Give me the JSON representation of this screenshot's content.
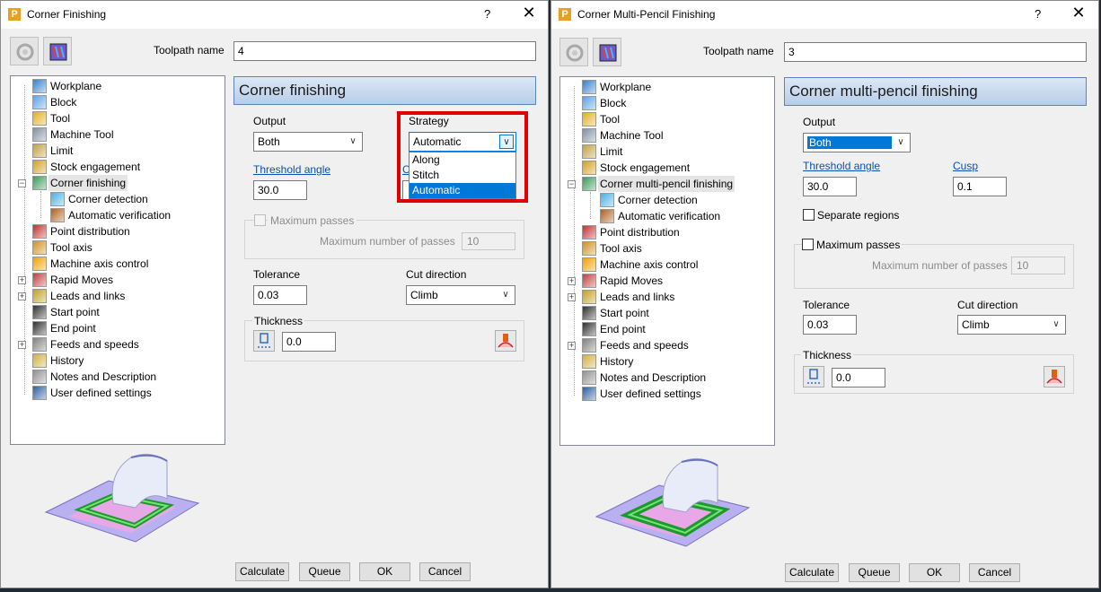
{
  "dialog1": {
    "title": "Corner Finishing",
    "help": "?",
    "close": "✕",
    "toolpath_name_label": "Toolpath name",
    "toolpath_name_value": "4",
    "tree": [
      {
        "label": "Workplane",
        "icon": "workplane-icon"
      },
      {
        "label": "Block",
        "icon": "block-icon"
      },
      {
        "label": "Tool",
        "icon": "tool-icon"
      },
      {
        "label": "Machine Tool",
        "icon": "machine-tool-icon"
      },
      {
        "label": "Limit",
        "icon": "limit-icon"
      },
      {
        "label": "Stock engagement",
        "icon": "stock-engagement-icon"
      },
      {
        "label": "Corner finishing",
        "icon": "corner-finishing-icon"
      },
      {
        "label": "Corner detection",
        "icon": "corner-detection-icon"
      },
      {
        "label": "Automatic verification",
        "icon": "verification-icon"
      },
      {
        "label": "Point distribution",
        "icon": "point-distribution-icon"
      },
      {
        "label": "Tool axis",
        "icon": "tool-axis-icon"
      },
      {
        "label": "Machine axis control",
        "icon": "machine-axis-icon"
      },
      {
        "label": "Rapid Moves",
        "icon": "rapid-moves-icon"
      },
      {
        "label": "Leads and links",
        "icon": "leads-links-icon"
      },
      {
        "label": "Start point",
        "icon": "start-point-icon"
      },
      {
        "label": "End point",
        "icon": "end-point-icon"
      },
      {
        "label": "Feeds and speeds",
        "icon": "feeds-speeds-icon"
      },
      {
        "label": "History",
        "icon": "history-icon"
      },
      {
        "label": "Notes and Description",
        "icon": "notes-icon"
      },
      {
        "label": "User defined settings",
        "icon": "user-settings-icon"
      }
    ],
    "section_title": "Corner finishing",
    "output_label": "Output",
    "output_value": "Both",
    "strategy_label": "Strategy",
    "strategy_value": "Automatic",
    "strategy_options": [
      "Along",
      "Stitch",
      "Automatic"
    ],
    "threshold_label": "Threshold angle",
    "threshold_value": "30.0",
    "cusp_partial": "C",
    "max_passes_label": "Maximum passes",
    "max_passes_number_label": "Maximum number of passes",
    "max_passes_number_value": "10",
    "tolerance_label": "Tolerance",
    "tolerance_value": "0.03",
    "cut_direction_label": "Cut direction",
    "cut_direction_value": "Climb",
    "thickness_label": "Thickness",
    "thickness_value": "0.0",
    "buttons": {
      "calculate": "Calculate",
      "queue": "Queue",
      "ok": "OK",
      "cancel": "Cancel"
    }
  },
  "dialog2": {
    "title": "Corner Multi-Pencil Finishing",
    "help": "?",
    "close": "✕",
    "toolpath_name_label": "Toolpath name",
    "toolpath_name_value": "3",
    "tree": [
      {
        "label": "Workplane",
        "icon": "workplane-icon"
      },
      {
        "label": "Block",
        "icon": "block-icon"
      },
      {
        "label": "Tool",
        "icon": "tool-icon"
      },
      {
        "label": "Machine Tool",
        "icon": "machine-tool-icon"
      },
      {
        "label": "Limit",
        "icon": "limit-icon"
      },
      {
        "label": "Stock engagement",
        "icon": "stock-engagement-icon"
      },
      {
        "label": "Corner multi-pencil finishing",
        "icon": "corner-finishing-icon"
      },
      {
        "label": "Corner detection",
        "icon": "corner-detection-icon"
      },
      {
        "label": "Automatic verification",
        "icon": "verification-icon"
      },
      {
        "label": "Point distribution",
        "icon": "point-distribution-icon"
      },
      {
        "label": "Tool axis",
        "icon": "tool-axis-icon"
      },
      {
        "label": "Machine axis control",
        "icon": "machine-axis-icon"
      },
      {
        "label": "Rapid Moves",
        "icon": "rapid-moves-icon"
      },
      {
        "label": "Leads and links",
        "icon": "leads-links-icon"
      },
      {
        "label": "Start point",
        "icon": "start-point-icon"
      },
      {
        "label": "End point",
        "icon": "end-point-icon"
      },
      {
        "label": "Feeds and speeds",
        "icon": "feeds-speeds-icon"
      },
      {
        "label": "History",
        "icon": "history-icon"
      },
      {
        "label": "Notes and Description",
        "icon": "notes-icon"
      },
      {
        "label": "User defined settings",
        "icon": "user-settings-icon"
      }
    ],
    "section_title": "Corner multi-pencil finishing",
    "output_label": "Output",
    "output_value": "Both",
    "threshold_label": "Threshold angle",
    "threshold_value": "30.0",
    "cusp_label": "Cusp",
    "cusp_value": "0.1",
    "separate_regions_label": "Separate regions",
    "max_passes_label": "Maximum passes",
    "max_passes_number_label": "Maximum number of passes",
    "max_passes_number_value": "10",
    "tolerance_label": "Tolerance",
    "tolerance_value": "0.03",
    "cut_direction_label": "Cut direction",
    "cut_direction_value": "Climb",
    "thickness_label": "Thickness",
    "thickness_value": "0.0",
    "buttons": {
      "calculate": "Calculate",
      "queue": "Queue",
      "ok": "OK",
      "cancel": "Cancel"
    }
  },
  "colors": {
    "highlight_box": "#e00000",
    "selection_blue": "#0078d7",
    "link_blue": "#0a4fb4",
    "header_gradient_top": "#dce8f6",
    "header_gradient_bottom": "#b7cde8"
  }
}
